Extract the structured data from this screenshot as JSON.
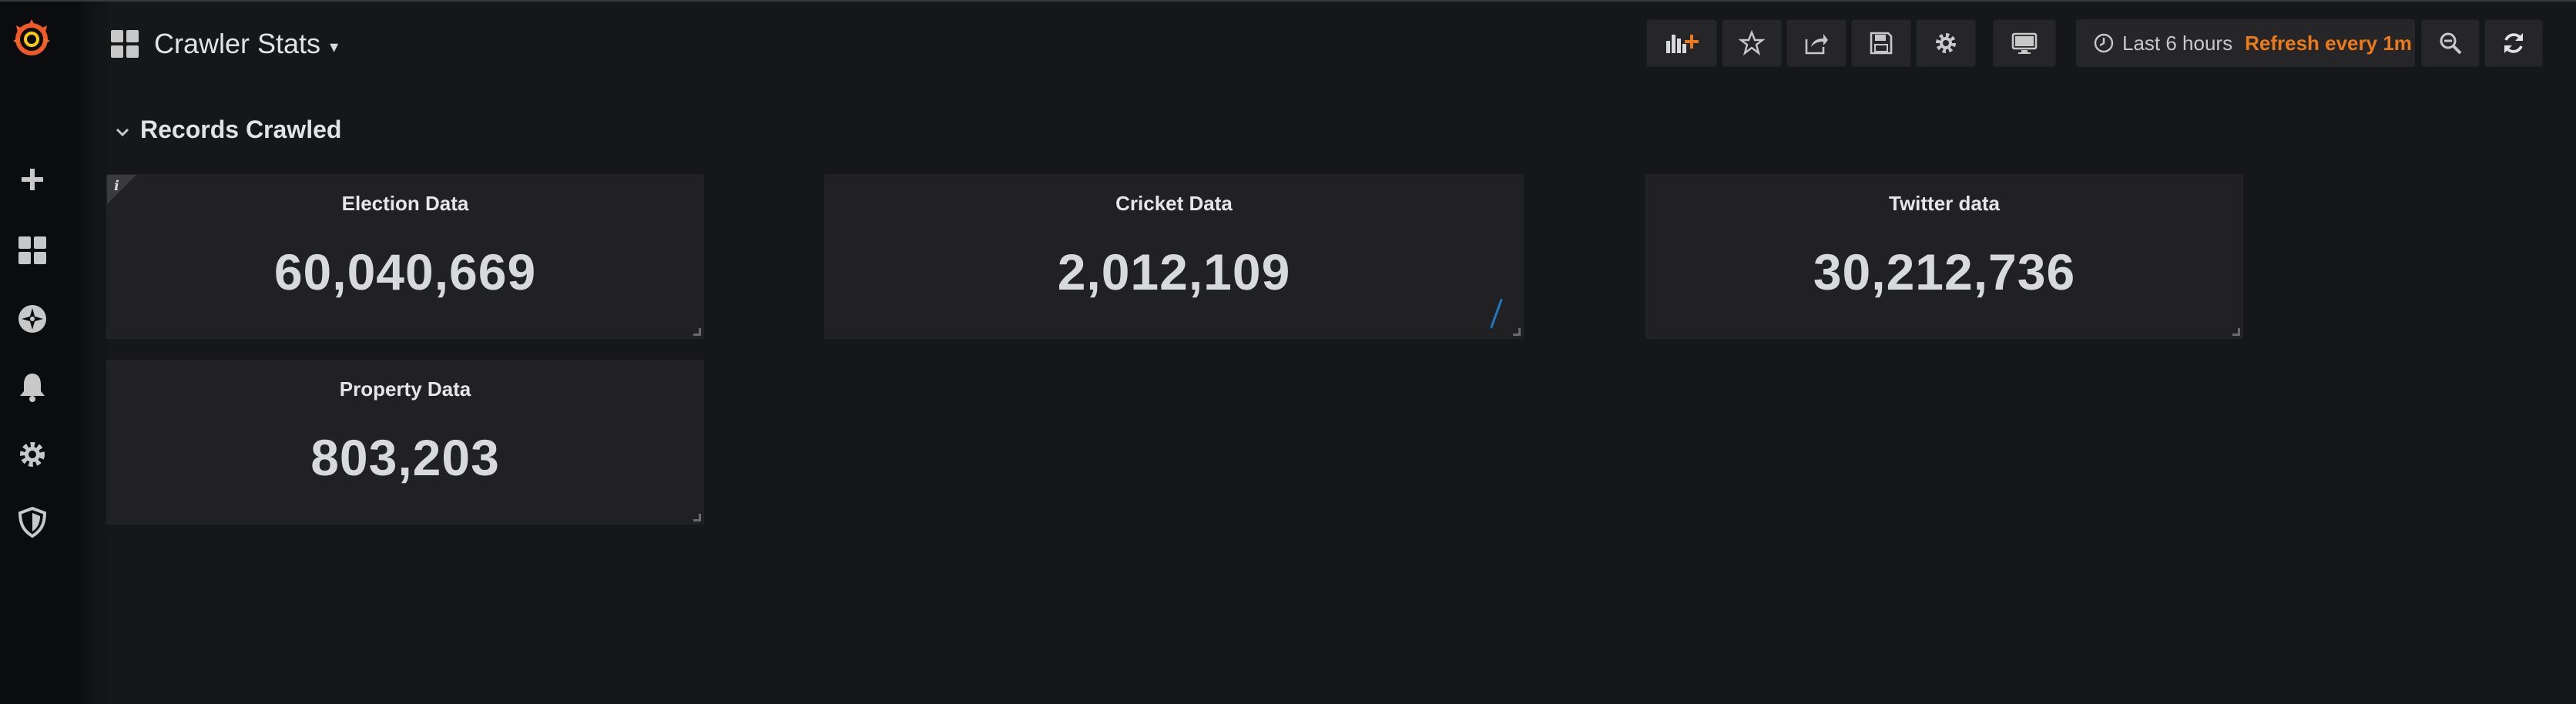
{
  "header": {
    "dashboard_title": "Crawler Stats",
    "time_range": "Last 6 hours",
    "refresh": "Refresh every 1m"
  },
  "sidebar": {
    "items": [
      {
        "icon": "plus-icon"
      },
      {
        "icon": "dashboards-icon"
      },
      {
        "icon": "explore-compass-icon"
      },
      {
        "icon": "alerting-bell-icon"
      },
      {
        "icon": "configuration-gear-icon"
      },
      {
        "icon": "server-admin-shield-icon"
      }
    ]
  },
  "toolbar": {
    "buttons": [
      "add-panel-icon",
      "star-icon",
      "share-icon",
      "save-icon",
      "settings-icon",
      "tv-mode-icon",
      "zoom-out-icon",
      "refresh-icon"
    ]
  },
  "row": {
    "title": "Records Crawled"
  },
  "panels": [
    {
      "title": "Election Data",
      "value": "60,040,669"
    },
    {
      "title": "Cricket Data",
      "value": "2,012,109"
    },
    {
      "title": "Twitter data",
      "value": "30,212,736"
    },
    {
      "title": "Property Data",
      "value": "803,203"
    }
  ],
  "colors": {
    "background": "#161719",
    "panel": "#212124",
    "accent_orange": "#eb7b18",
    "sidebar": "#0b0c0e"
  }
}
